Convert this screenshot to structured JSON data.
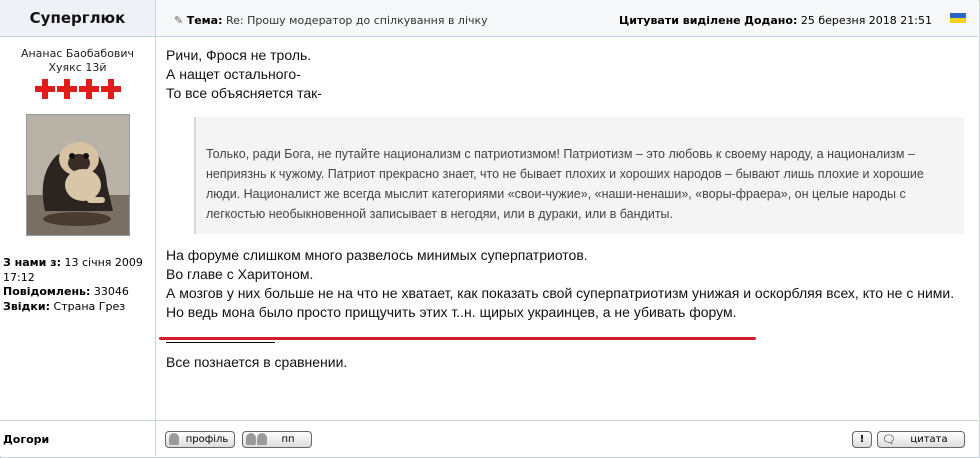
{
  "author": {
    "name": "Суперглюк",
    "rank_line1": "Ананас Баобабович",
    "rank_line2": "Хуякс 13й",
    "joined_label": "З нами з:",
    "joined_value": "13 січня 2009 17:12",
    "posts_label": "Повідомлень:",
    "posts_value": "33046",
    "from_label": "Звідки:",
    "from_value": "Страна Грез",
    "top_link": "Догори"
  },
  "post": {
    "subject_label": "Тема:",
    "subject_value": "Re: Прошу модератор до спілкування в лічку",
    "quote_selected": "Цитувати виділене",
    "added_label": "Додано:",
    "added_value": "25 березня 2018 21:51",
    "lines_top": [
      "Ричи, Фрося не троль.",
      "А нащет остального-",
      "То все объясняется так-"
    ],
    "quote_text": "Только, ради Бога, не путайте национализм с патриотизмом! Патриотизм – это любовь к своему народу, а национализм – неприязнь к чужому. Патриот прекрасно знает, что не бывает плохих и хороших народов – бывают лишь плохие и хорошие люди. Националист же всегда мыслит категориями «свои-чужие», «наши-ненаши», «воры-фраера», он целые народы с легкостью необыкновенной записывает в негодяи, или в дураки, или в бандиты.",
    "lines_bottom": [
      "На форуме слишком много развелось минимых суперпатриотов.",
      "Во главе с Харитоном.",
      "А мозгов у них больше не на что не хватает, как показать свой суперпатриотизм унижая и оскорбляя всех, кто не с ними.",
      "Но ведь мона было просто прищучить этих т..н. щирых украинцев, а не убивать форум."
    ],
    "signature": "Все познается в сравнении."
  },
  "buttons": {
    "profile": "профіль",
    "pm": "пп",
    "report": "!",
    "quote": "цитата"
  }
}
